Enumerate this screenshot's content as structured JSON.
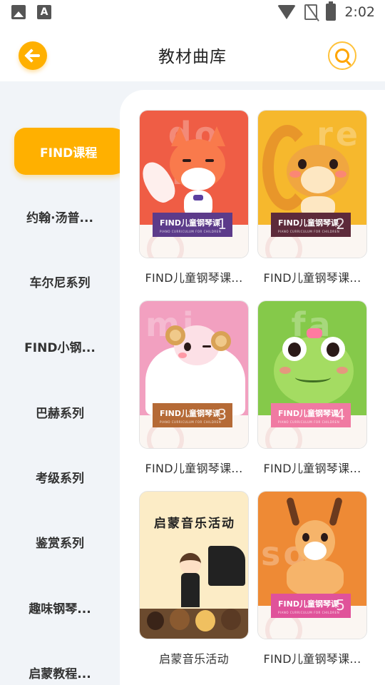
{
  "status_bar": {
    "left_icons": [
      "gallery-icon",
      "font-icon"
    ],
    "font_icon_glyph": "A",
    "right_icons": [
      "wifi-icon",
      "no-sim-icon",
      "battery-charging-icon"
    ],
    "time": "2:02"
  },
  "header": {
    "title": "教材曲库",
    "back_icon": "arrow-left-icon",
    "search_icon": "search-icon"
  },
  "colors": {
    "accent": "#ffb000",
    "background": "#f1f4f8"
  },
  "sidebar": {
    "items": [
      {
        "label": "FIND课程",
        "active": true
      },
      {
        "label": "约翰·汤普...",
        "active": false
      },
      {
        "label": "车尔尼系列",
        "active": false
      },
      {
        "label": "FIND小钢...",
        "active": false
      },
      {
        "label": "巴赫系列",
        "active": false
      },
      {
        "label": "考级系列",
        "active": false
      },
      {
        "label": "鉴赏系列",
        "active": false
      },
      {
        "label": "趣味钢琴...",
        "active": false
      },
      {
        "label": "启蒙教程...",
        "active": false
      }
    ]
  },
  "books": [
    {
      "title": "FIND儿童钢琴课...",
      "cover_label": "FIND儿童钢琴课",
      "cover_sub": "PIANO CURRICULUM FOR CHILDREN",
      "number": "1",
      "bg_word": "do re"
    },
    {
      "title": "FIND儿童钢琴课...",
      "cover_label": "FIND儿童钢琴课",
      "cover_sub": "PIANO CURRICULUM FOR CHILDREN",
      "number": "2",
      "bg_word": "re"
    },
    {
      "title": "FIND儿童钢琴课...",
      "cover_label": "FIND儿童钢琴课",
      "cover_sub": "PIANO CURRICULUM FOR CHILDREN",
      "number": "3",
      "bg_word": "mi"
    },
    {
      "title": "FIND儿童钢琴课...",
      "cover_label": "FIND儿童钢琴课",
      "cover_sub": "PIANO CURRICULUM FOR CHILDREN",
      "number": "4",
      "bg_word": "fa"
    },
    {
      "title": "启蒙音乐活动",
      "cover_label": "启蒙音乐活动",
      "cover_sub": "",
      "number": "",
      "bg_word": ""
    },
    {
      "title": "FIND儿童钢琴课...",
      "cover_label": "FIND儿童钢琴课",
      "cover_sub": "PIANO CURRICULUM FOR CHILDREN",
      "number": "5",
      "bg_word": "sol"
    }
  ]
}
